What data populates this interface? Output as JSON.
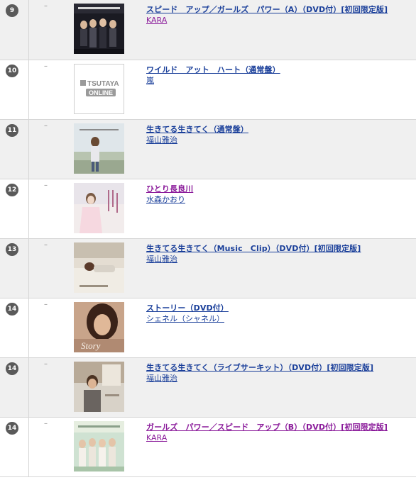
{
  "ranking": {
    "items": [
      {
        "rank": "9",
        "change": "–",
        "title": "スピード　アップ／ガールズ　パワー（A）（DVD付）[初回限定版]",
        "artist": "KARA",
        "cover": "cover-kara-a-image"
      },
      {
        "rank": "10",
        "change": "–",
        "title": "ワイルド　アット　ハート（通常盤）",
        "artist": "嵐",
        "cover": "tsutaya-online-placeholder-image",
        "placeholder_brand": "TSUTAYA",
        "placeholder_sub": "ONLINE"
      },
      {
        "rank": "11",
        "change": "–",
        "title": "生きてる生きてく（通常盤）",
        "artist": "福山雅治",
        "cover": "cover-fukuyama-regular-image"
      },
      {
        "rank": "12",
        "change": "–",
        "title": "ひとり長良川",
        "artist": "水森かおり",
        "cover": "cover-mizumori-image"
      },
      {
        "rank": "13",
        "change": "–",
        "title": "生きてる生きてく（Music　Clip）（DVD付）[初回限定版]",
        "artist": "福山雅治",
        "cover": "cover-fukuyama-musicclip-image"
      },
      {
        "rank": "14",
        "change": "–",
        "title": "ストーリー（DVD付）",
        "artist": "シェネル（シャネル）",
        "cover": "cover-chenelle-image",
        "cover_text": "Story"
      },
      {
        "rank": "14",
        "change": "–",
        "title": "生きてる生きてく（ライブサーキット）（DVD付）[初回限定版]",
        "artist": "福山雅治",
        "cover": "cover-fukuyama-live-image"
      },
      {
        "rank": "14",
        "change": "–",
        "title": "ガールズ　パワー／スピード　アップ（B）（DVD付）[初回限定版]",
        "artist": "KARA",
        "cover": "cover-kara-b-image"
      }
    ]
  },
  "colors": {
    "link": "#1a3f9a",
    "visited_link": "#8a1a9a",
    "badge": "#5a5a5a",
    "row_shade": "#f0f0f0",
    "divider": "#d6d6d6"
  }
}
